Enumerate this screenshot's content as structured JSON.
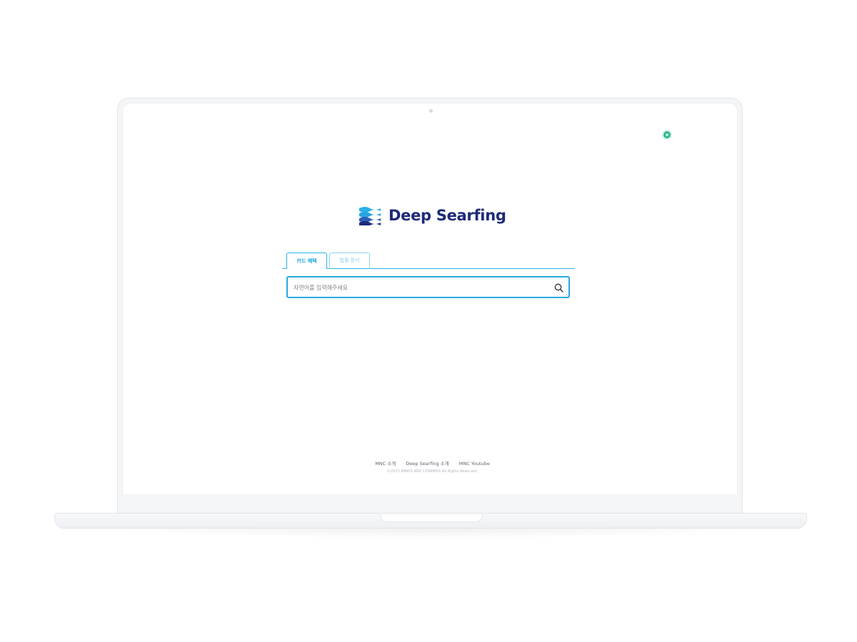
{
  "status": {
    "label": "",
    "color": "#2fb88a"
  },
  "brand": {
    "name": "Deep Searfing",
    "text_color": "#1e2a7a",
    "accent": "#27a9e0"
  },
  "tabs": [
    {
      "label": "카드 혜택",
      "active": true
    },
    {
      "label": "법률 문서",
      "active": false
    }
  ],
  "search": {
    "placeholder": "자연어를 입력해주세요",
    "value": ""
  },
  "footer": {
    "links": [
      "MNC 소개",
      "Deep Searfing 소개",
      "MNC Youtube"
    ],
    "copyright": "©2023 MINDS AND COMPANY. All Rights Reserved."
  }
}
